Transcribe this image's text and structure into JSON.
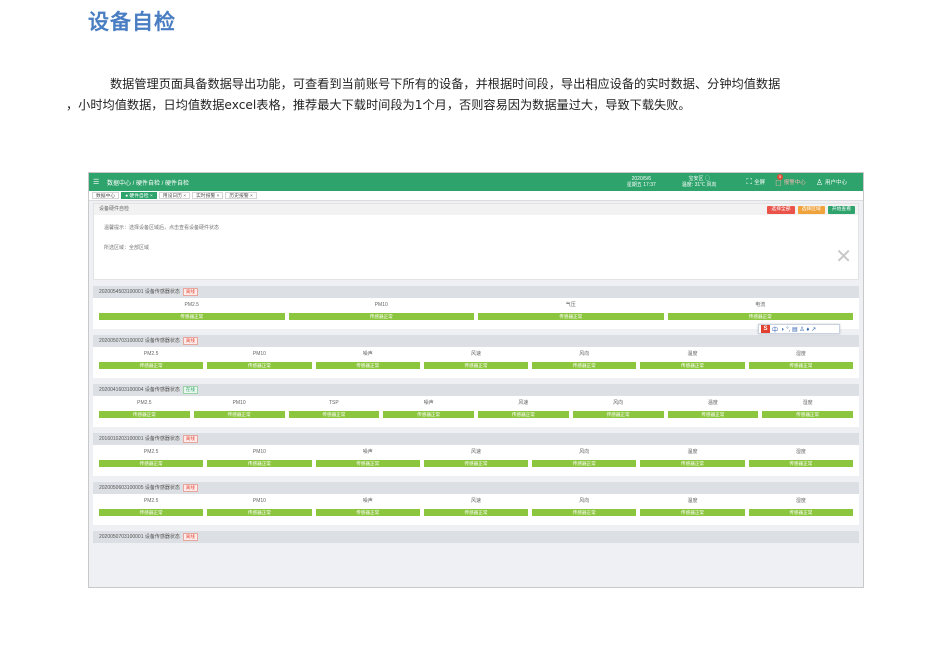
{
  "doc": {
    "title": "设备自检",
    "paragraph_line1": "数据管理页面具备数据导出功能，可查看到当前账号下所有的设备，并根据时间段，导出相应设备的实时数据、分钟均值数据",
    "paragraph_line2": "，小时均值数据，日均值数据excel表格，推荐最大下载时间段为1个月，否则容易因为数据量过大，导致下载失败。"
  },
  "app": {
    "breadcrumb": "数据中心 / 硬件自检 / 硬件自检",
    "date": "2020/5/6",
    "weekday_time": "星期五 17:37",
    "location": "宝安区 ◯",
    "weather": "温度: 31℃ 风向",
    "fullscreen_label": "全屏",
    "alarm_label": "报警中心",
    "alarm_count": "5",
    "user_label": "用户中心",
    "tabs": [
      "数据中心",
      "● 硬件自检 ×",
      "用设日历 ×",
      "实时报警 ×",
      "历史报警 ×"
    ],
    "panel": {
      "title": "设备硬件自检",
      "buttons": [
        "选择全部",
        "选择区域",
        "开始查看"
      ],
      "hint": "温馨提示：选择设备区域后，点击查看设备硬件状态",
      "region": "所选区域：全部区域"
    },
    "ok_text": "传感器正常",
    "devices": [
      {
        "header": "2020054503100001 设备传感器状态",
        "status": "离线",
        "online": false,
        "sensors": [
          "PM2.5",
          "PM10",
          "气压",
          "电流"
        ]
      },
      {
        "header": "2020050703100002 设备传感器状态",
        "status": "离线",
        "online": false,
        "sensors": [
          "PM2.5",
          "PM10",
          "噪声",
          "风速",
          "风向",
          "温度",
          "湿度"
        ]
      },
      {
        "header": "2020041603100004 设备传感器状态",
        "status": "在线",
        "online": true,
        "sensors": [
          "PM2.5",
          "PM10",
          "TSP",
          "噪声",
          "风速",
          "风向",
          "温度",
          "湿度"
        ]
      },
      {
        "header": "2016010203100001 设备传感器状态",
        "status": "离线",
        "online": false,
        "sensors": [
          "PM2.5",
          "PM10",
          "噪声",
          "风速",
          "风向",
          "温度",
          "湿度"
        ]
      },
      {
        "header": "2020050603100005 设备传感器状态",
        "status": "离线",
        "online": false,
        "sensors": [
          "PM2.5",
          "PM10",
          "噪声",
          "风速",
          "风向",
          "温度",
          "湿度"
        ]
      },
      {
        "header": "2020050703100001 设备传感器状态",
        "status": "离线",
        "online": false,
        "sensors": []
      }
    ],
    "ime": {
      "logo": "S",
      "lang": "中",
      "tools": "◗ °, ▤ ♙ ♦ ↗"
    },
    "colors": {
      "primary": "#2ea36c",
      "ok": "#8cc63f",
      "danger": "#e24b3b",
      "btn_red": "#e9534a",
      "btn_orange": "#f0a23b",
      "btn_green": "#2ea36c"
    }
  }
}
